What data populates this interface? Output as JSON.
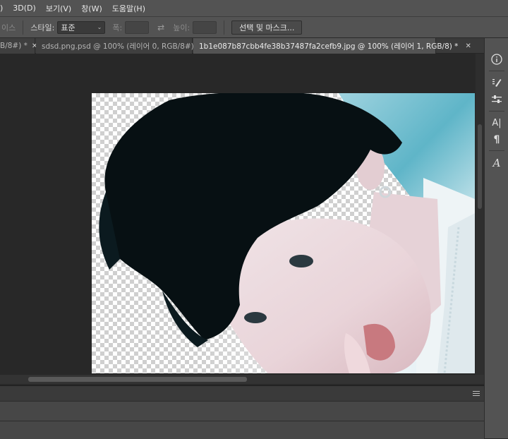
{
  "menu": [
    ")",
    "3D(D)",
    "보기(V)",
    "창(W)",
    "도움말(H)"
  ],
  "options": {
    "faded_label": "이스",
    "style_label": "스타일:",
    "style_value": "표준",
    "width_label": "폭:",
    "swap_icon": "swap-arrows-icon",
    "height_label": "높이:",
    "select_mask_button": "선택 및 마스크..."
  },
  "tabs": [
    {
      "label": "B/8#) *",
      "close": "✕",
      "active": false
    },
    {
      "label": "sdsd.png.psd @ 100% (레이어 0, RGB/8#)",
      "close": "✕",
      "active": false
    },
    {
      "label": "1b1e087b87cbb4fe38b37487fa2cefb9.jpg @ 100% (레이어 1, RGB/8) *",
      "close": "✕",
      "active": true
    }
  ],
  "right_panel_icons": [
    "info-icon",
    "brush-settings-icon",
    "adjustments-icon",
    "character-icon",
    "paragraph-icon",
    "glyphs-icon"
  ],
  "right_panel_glyphs": {
    "info": "ⓘ",
    "character": "A|",
    "paragraph": "¶",
    "glyphs": "A"
  },
  "colors": {
    "chrome": "#535353",
    "workspace": "#282828",
    "active_tab": "#535353"
  }
}
